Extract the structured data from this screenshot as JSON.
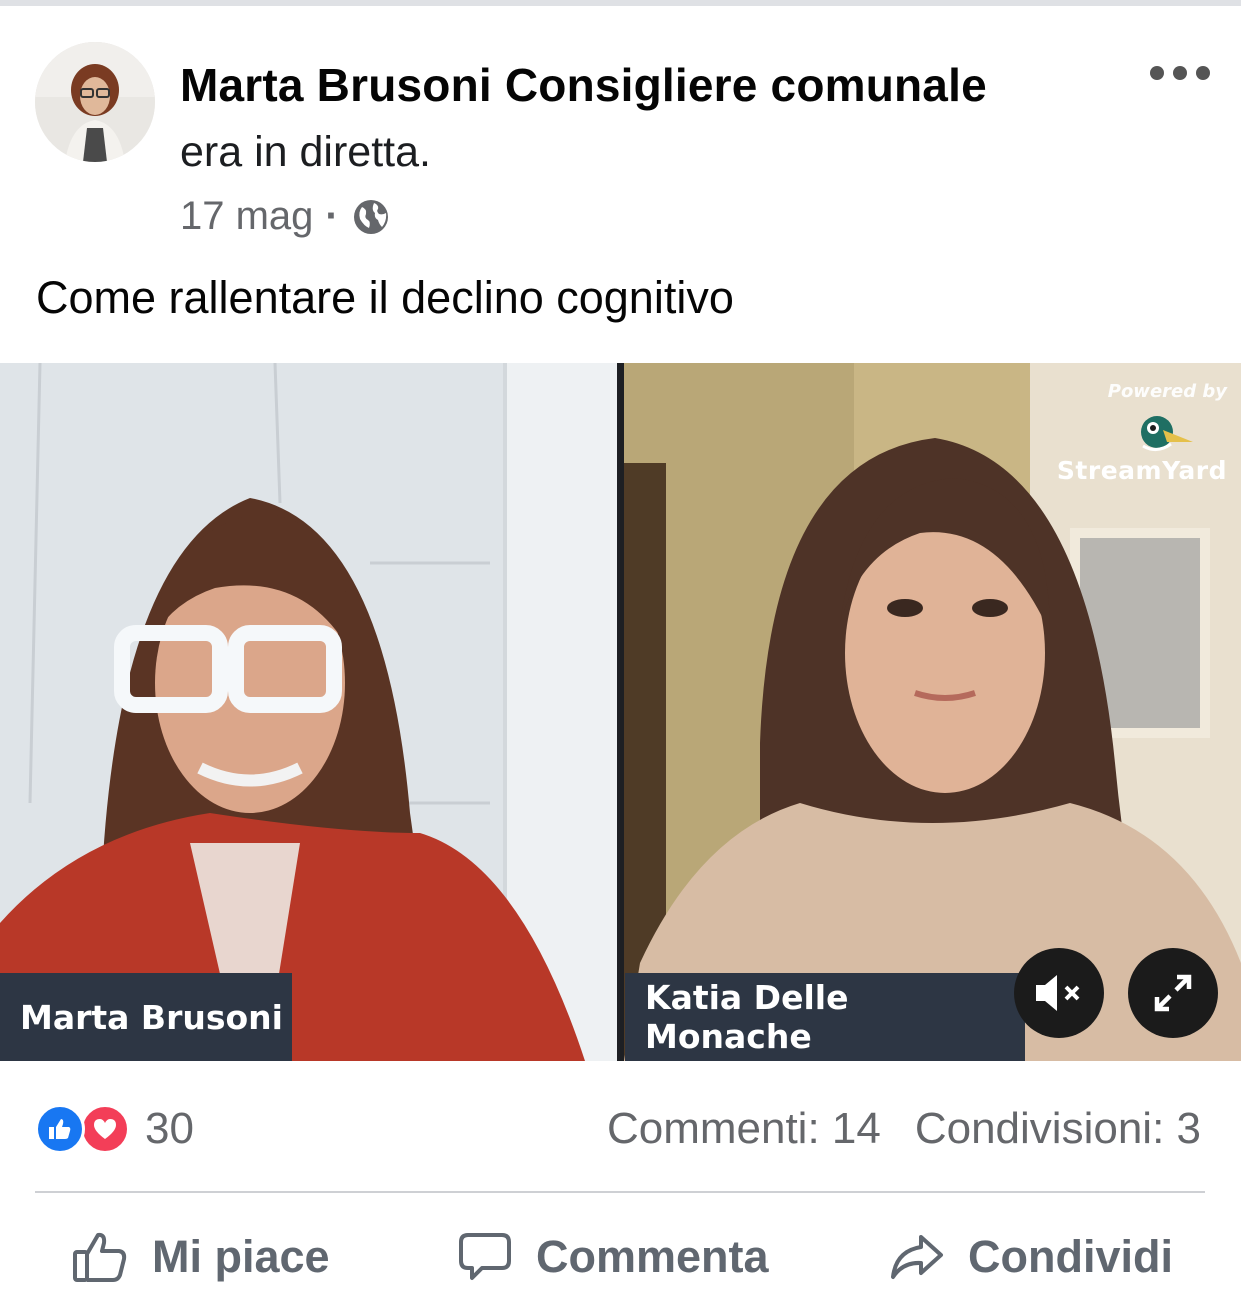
{
  "post": {
    "author": "Marta Brusoni Consigliere comunale",
    "action": "era in diretta.",
    "date": "17 mag",
    "separator": "·",
    "privacy_icon": "globe-icon",
    "text": "Come rallentare il declino cognitivo"
  },
  "video": {
    "left_participant": "Marta Brusoni",
    "right_participant": "Katia Delle Monache",
    "branding_powered": "Powered by",
    "branding_name": "StreamYard",
    "mute_icon": "speaker-muted-icon",
    "fullscreen_icon": "expand-icon"
  },
  "stats": {
    "reaction_count": "30",
    "comments": "Commenti: 14",
    "shares": "Condivisioni: 3"
  },
  "actions": {
    "like": "Mi piace",
    "comment": "Commenta",
    "share": "Condividi"
  },
  "colors": {
    "like_blue": "#1877f2",
    "love_red": "#f33e58",
    "secondary_text": "#65676b",
    "name_tag_bg": "#2d3644"
  }
}
